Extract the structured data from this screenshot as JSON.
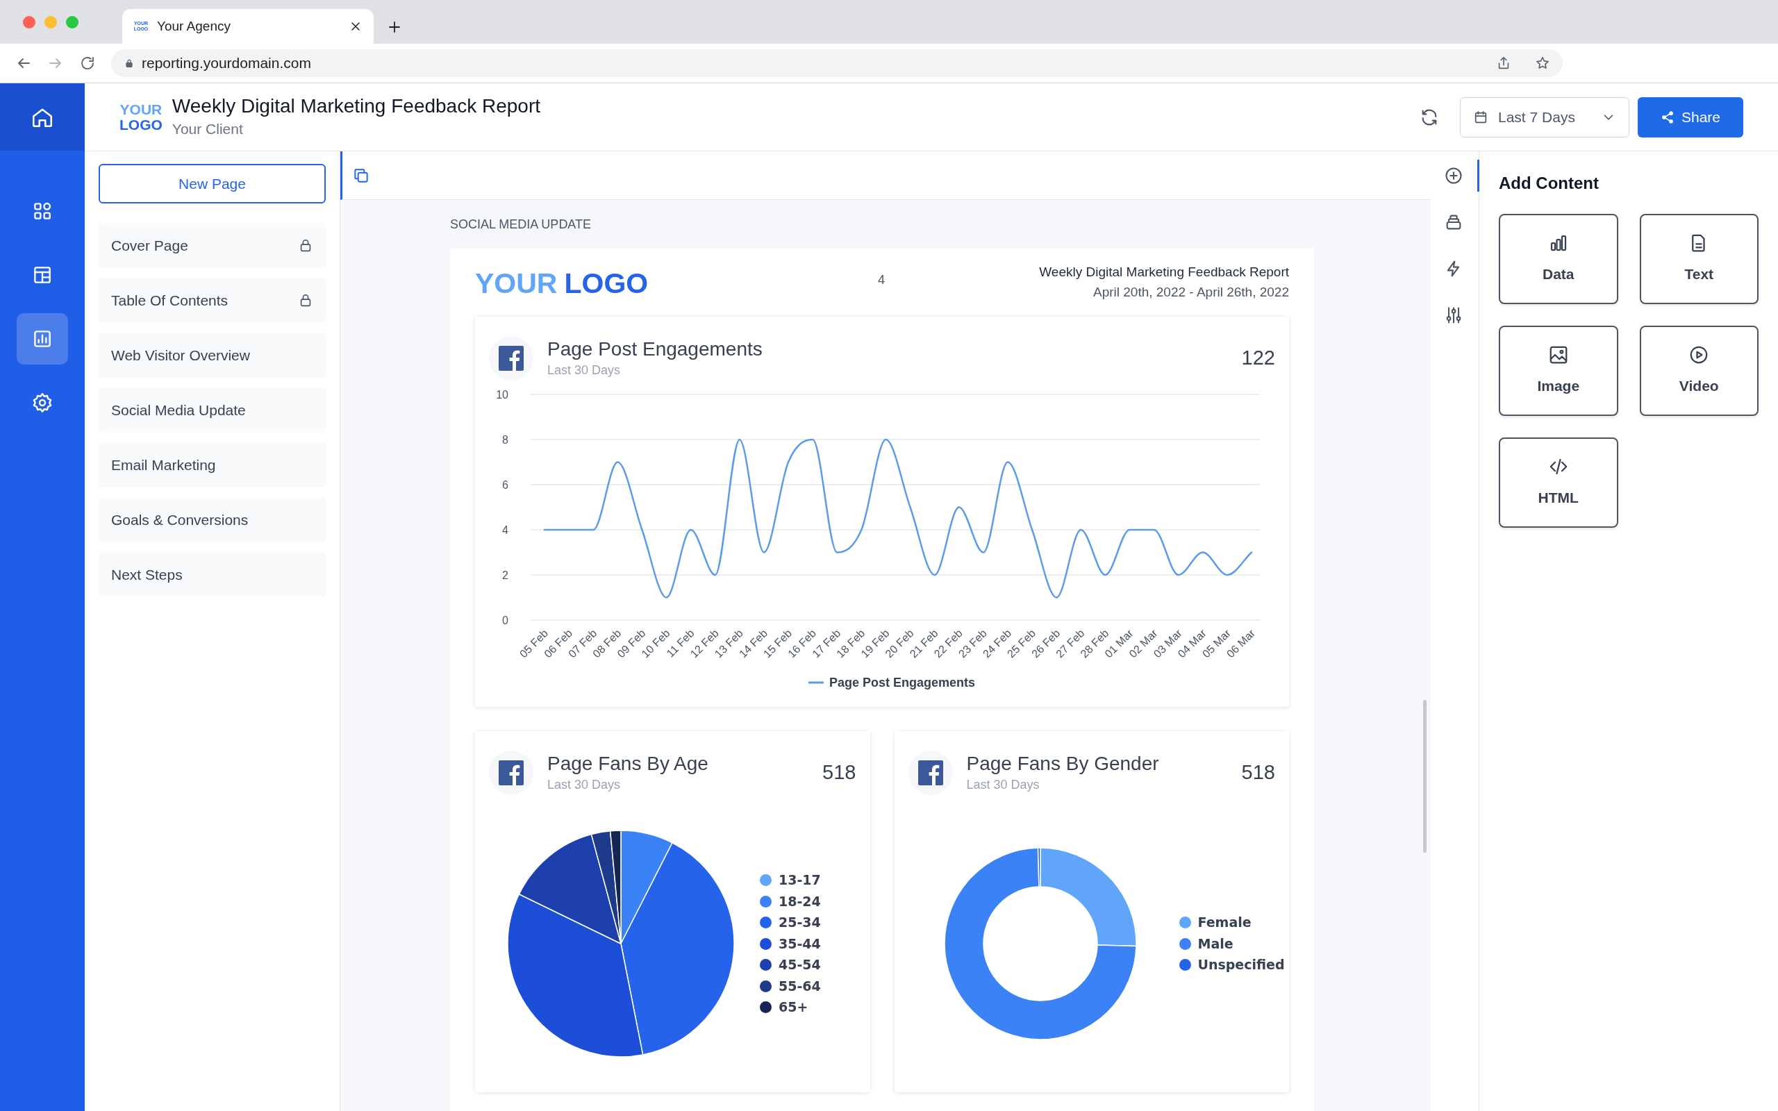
{
  "browser": {
    "tab": {
      "favicon_text": "YOUR LOGO",
      "title": "Your Agency"
    },
    "url": "reporting.yourdomain.com"
  },
  "rail": [
    {
      "kind": "apps",
      "selected": false
    },
    {
      "kind": "layout",
      "selected": false
    },
    {
      "kind": "reports",
      "selected": true
    },
    {
      "kind": "settings",
      "selected": false
    }
  ],
  "header": {
    "logo_top": "YOUR",
    "logo_bottom": "LOGO",
    "title": "Weekly Digital Marketing Feedback Report",
    "subtitle": "Your Client",
    "date_range": "Last 7 Days",
    "share": "Share"
  },
  "pages": {
    "new_page": "New Page",
    "items": [
      {
        "label": "Cover Page",
        "locked": true
      },
      {
        "label": "Table Of Contents",
        "locked": true
      },
      {
        "label": "Web Visitor Overview",
        "locked": false
      },
      {
        "label": "Social Media Update",
        "locked": false
      },
      {
        "label": "Email Marketing",
        "locked": false
      },
      {
        "label": "Goals & Conversions",
        "locked": false
      },
      {
        "label": "Next Steps",
        "locked": false
      }
    ]
  },
  "canvas": {
    "section_label": "SOCIAL MEDIA UPDATE",
    "report": {
      "logo_a": "YOUR",
      "logo_b": "LOGO",
      "page_number": "4",
      "title": "Weekly Digital Marketing Feedback Report",
      "dates": "April 20th, 2022 - April 26th, 2022"
    },
    "widgets": [
      {
        "kind": "line",
        "title": "Page Post Engagements",
        "subtitle": "Last 30 Days",
        "value": "122",
        "chart_data": {
          "type": "line",
          "grid": true,
          "categories": [
            "05 Feb",
            "06 Feb",
            "07 Feb",
            "08 Feb",
            "09 Feb",
            "10 Feb",
            "11 Feb",
            "12 Feb",
            "13 Feb",
            "14 Feb",
            "15 Feb",
            "16 Feb",
            "17 Feb",
            "18 Feb",
            "19 Feb",
            "20 Feb",
            "21 Feb",
            "22 Feb",
            "23 Feb",
            "24 Feb",
            "25 Feb",
            "26 Feb",
            "27 Feb",
            "28 Feb",
            "01 Mar",
            "02 Mar",
            "03 Mar",
            "04 Mar",
            "05 Mar",
            "06 Mar"
          ],
          "ylim": [
            0,
            10
          ],
          "yticks": [
            0,
            2,
            4,
            6,
            8,
            10
          ],
          "series": [
            {
              "name": "Page Post Engagements",
              "color": "#5b9bea",
              "values": [
                4,
                4,
                4,
                7,
                4,
                1,
                4,
                2,
                8,
                3,
                7,
                8,
                3,
                4,
                8,
                5,
                2,
                5,
                3,
                7,
                4,
                1,
                4,
                2,
                4,
                4,
                2,
                3,
                2,
                3
              ]
            }
          ]
        }
      },
      {
        "kind": "pie",
        "title": "Page Fans By Age",
        "subtitle": "Last 30 Days",
        "value": "518",
        "legend": [
          {
            "label": "13-17",
            "color": "#60a5fa"
          },
          {
            "label": "18-24",
            "color": "#3b82f6"
          },
          {
            "label": "25-34",
            "color": "#2563eb"
          },
          {
            "label": "35-44",
            "color": "#1d4ed8"
          },
          {
            "label": "45-54",
            "color": "#1e40af"
          },
          {
            "label": "55-64",
            "color": "#1e3a8a"
          },
          {
            "label": "65+",
            "color": "#172554"
          }
        ]
      },
      {
        "kind": "donut",
        "title": "Page Fans By Gender",
        "subtitle": "Last 30 Days",
        "value": "518",
        "legend": [
          {
            "label": "Female",
            "color": "#60a5fa"
          },
          {
            "label": "Male",
            "color": "#3b82f6"
          },
          {
            "label": "Unspecified",
            "color": "#2563eb"
          }
        ]
      }
    ]
  },
  "tools": [
    {
      "kind": "add",
      "selected": true
    },
    {
      "kind": "layers",
      "selected": false
    },
    {
      "kind": "bolt",
      "selected": false
    },
    {
      "kind": "sliders",
      "selected": false
    }
  ],
  "add_content": {
    "title": "Add Content",
    "tiles": [
      {
        "kind": "data",
        "label": "Data"
      },
      {
        "kind": "text",
        "label": "Text"
      },
      {
        "kind": "image",
        "label": "Image"
      },
      {
        "kind": "video",
        "label": "Video"
      },
      {
        "kind": "html",
        "label": "HTML"
      }
    ]
  }
}
